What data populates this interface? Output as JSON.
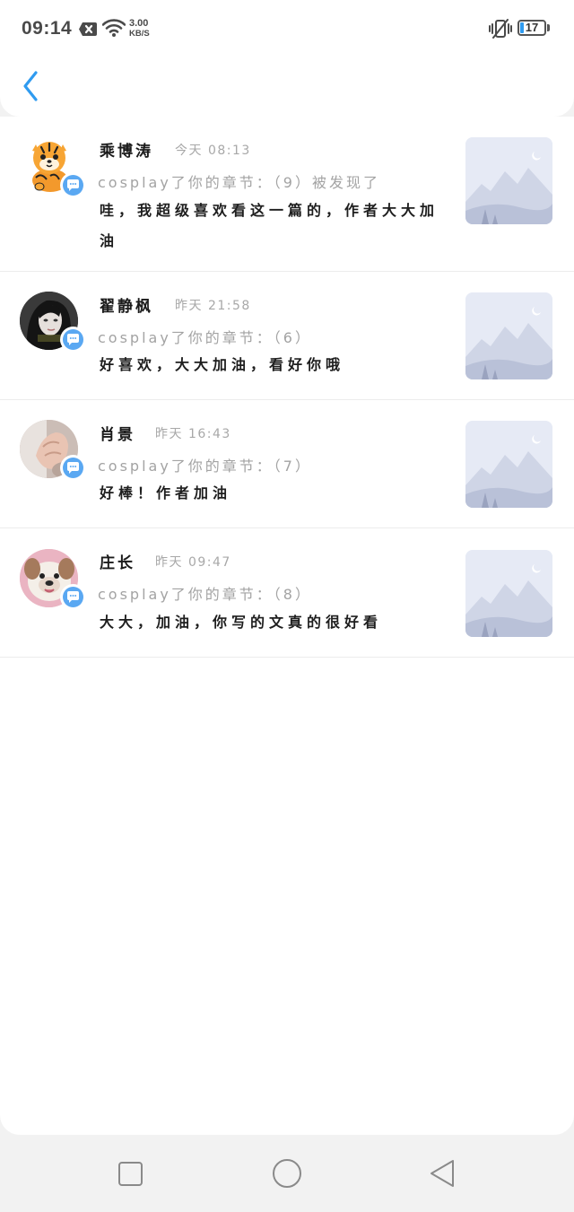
{
  "status_bar": {
    "time": "09:14",
    "net_speed_value": "3.00",
    "net_speed_unit": "KB/S",
    "battery_level": "17",
    "icons": [
      "notification-x-icon",
      "wifi-icon",
      "vibrate-off-icon",
      "battery-icon"
    ]
  },
  "header": {
    "back_icon": "chevron-left-icon"
  },
  "notifications": [
    {
      "name": "乘博涛",
      "time": "今天 08:13",
      "chapter": "cosplay了你的章节：（9）被发现了",
      "comment": "哇，我超级喜欢看这一篇的，作者大大加油",
      "avatar": "tiger-cartoon-avatar"
    },
    {
      "name": "翟静枫",
      "time": "昨天 21:58",
      "chapter": "cosplay了你的章节：（6）",
      "comment": "好喜欢，大大加油，看好你哦",
      "avatar": "woman-photo-avatar"
    },
    {
      "name": "肖景",
      "time": "昨天 16:43",
      "chapter": "cosplay了你的章节：（7）",
      "comment": "好棒！作者加油",
      "avatar": "hand-photo-avatar"
    },
    {
      "name": "庄长",
      "time": "昨天 09:47",
      "chapter": "cosplay了你的章节：（8）",
      "comment": "大大，加油，你写的文真的很好看",
      "avatar": "puppy-photo-avatar"
    }
  ],
  "colors": {
    "accent": "#2f9bf0",
    "badge": "#5aa8f2",
    "muted_text": "#a3a3a3"
  },
  "nav_bar": {
    "icons": [
      "recent-apps-square-icon",
      "home-circle-icon",
      "back-triangle-icon"
    ]
  }
}
